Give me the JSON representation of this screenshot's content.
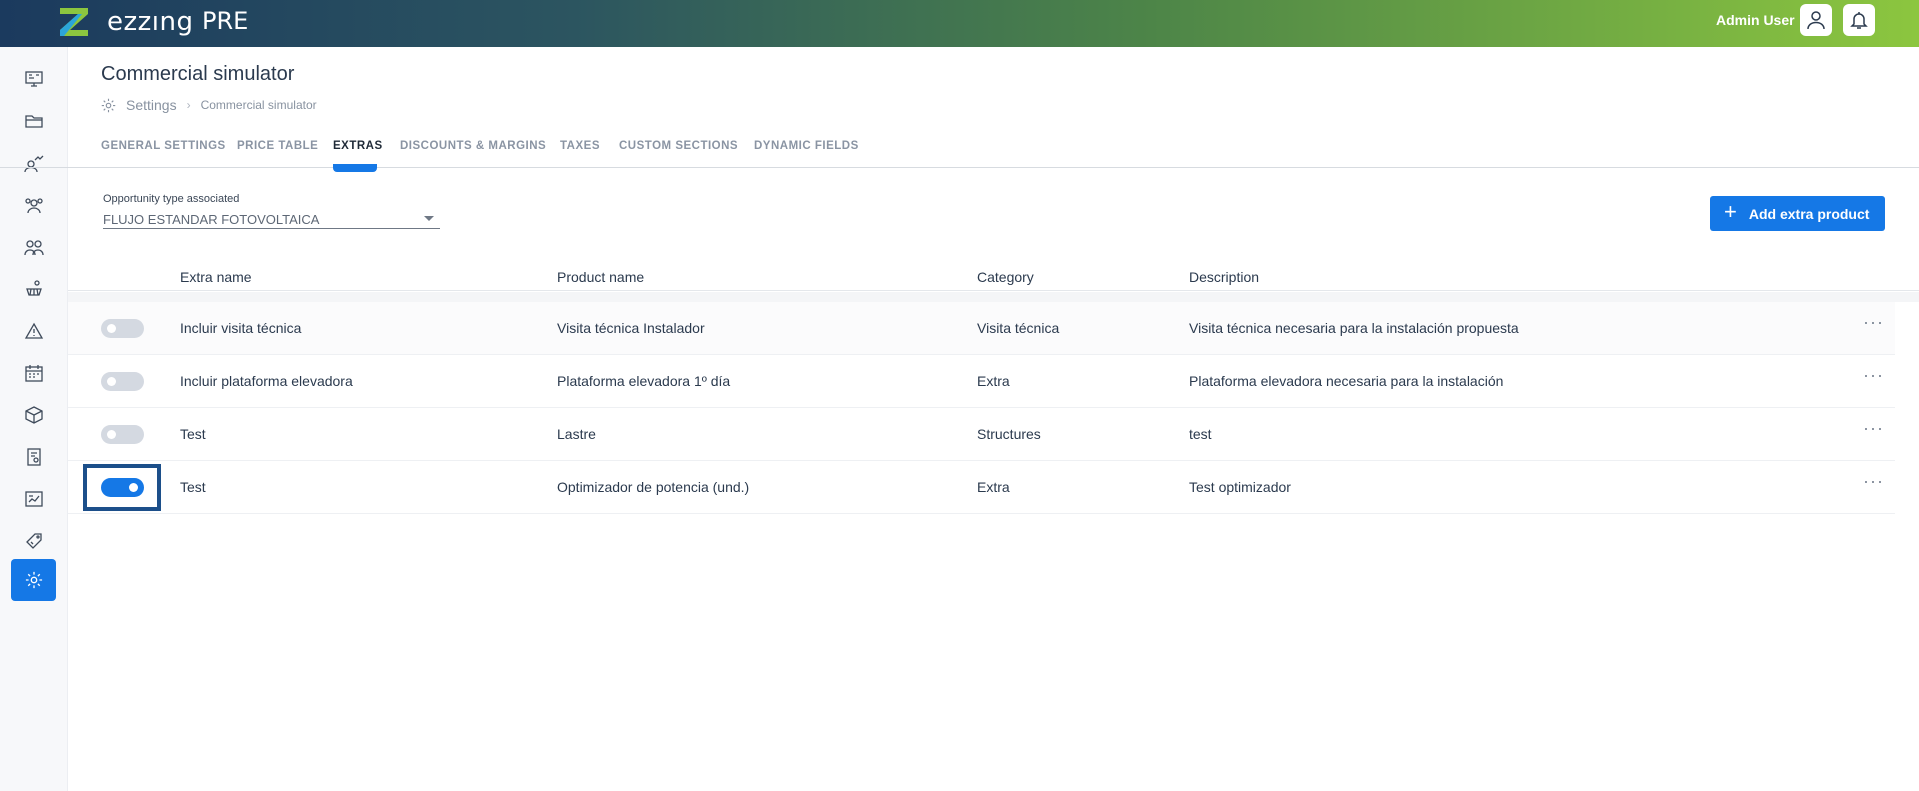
{
  "header": {
    "brand": "ezzıng",
    "environment": "PRE",
    "user_name": "Admin User",
    "colors": {
      "gradient_start": "#1b3a5e",
      "gradient_end": "#8cc63f"
    }
  },
  "sidebar": {
    "items": [
      {
        "name": "sidebar-item-dashboard",
        "icon": "monitor-icon"
      },
      {
        "name": "sidebar-item-folders",
        "icon": "folder-icon"
      },
      {
        "name": "sidebar-item-leads",
        "icon": "user-chart-icon"
      },
      {
        "name": "sidebar-item-teams",
        "icon": "team-icon"
      },
      {
        "name": "sidebar-item-contacts",
        "icon": "users-icon"
      },
      {
        "name": "sidebar-item-installations",
        "icon": "solar-panel-icon"
      },
      {
        "name": "sidebar-item-alerts",
        "icon": "warning-icon"
      },
      {
        "name": "sidebar-item-calendar",
        "icon": "calendar-icon"
      },
      {
        "name": "sidebar-item-products",
        "icon": "box-icon"
      },
      {
        "name": "sidebar-item-invoices",
        "icon": "invoice-icon"
      },
      {
        "name": "sidebar-item-reports",
        "icon": "report-icon"
      },
      {
        "name": "sidebar-item-pricing",
        "icon": "tag-icon"
      },
      {
        "name": "sidebar-item-settings",
        "icon": "gear-icon",
        "active": true
      }
    ]
  },
  "page": {
    "title": "Commercial simulator",
    "breadcrumb": {
      "root": "Settings",
      "current": "Commercial simulator"
    }
  },
  "tabs": [
    {
      "label": "GENERAL SETTINGS"
    },
    {
      "label": "PRICE TABLE"
    },
    {
      "label": "EXTRAS",
      "active": true
    },
    {
      "label": "DISCOUNTS & MARGINS"
    },
    {
      "label": "TAXES"
    },
    {
      "label": "CUSTOM SECTIONS"
    },
    {
      "label": "DYNAMIC FIELDS"
    }
  ],
  "filter": {
    "label": "Opportunity type associated",
    "value": "FLUJO ESTANDAR FOTOVOLTAICA"
  },
  "add_button": {
    "label": "Add extra product"
  },
  "table": {
    "columns": [
      "Extra name",
      "Product name",
      "Category",
      "Description"
    ],
    "rows": [
      {
        "enabled": false,
        "extra_name": "Incluir visita técnica",
        "product_name": "Visita técnica Instalador",
        "category": "Visita técnica",
        "description": "Visita técnica necesaria para la instalación propuesta"
      },
      {
        "enabled": false,
        "extra_name": "Incluir plataforma elevadora",
        "product_name": "Plataforma elevadora 1º día",
        "category": "Extra",
        "description": "Plataforma elevadora necesaria para la instalación"
      },
      {
        "enabled": false,
        "extra_name": "Test",
        "product_name": "Lastre",
        "category": "Structures",
        "description": "test"
      },
      {
        "enabled": true,
        "extra_name": "Test",
        "product_name": "Optimizador de potencia (und.)",
        "category": "Extra",
        "description": "Test optimizador"
      }
    ],
    "row_menu": "···"
  }
}
